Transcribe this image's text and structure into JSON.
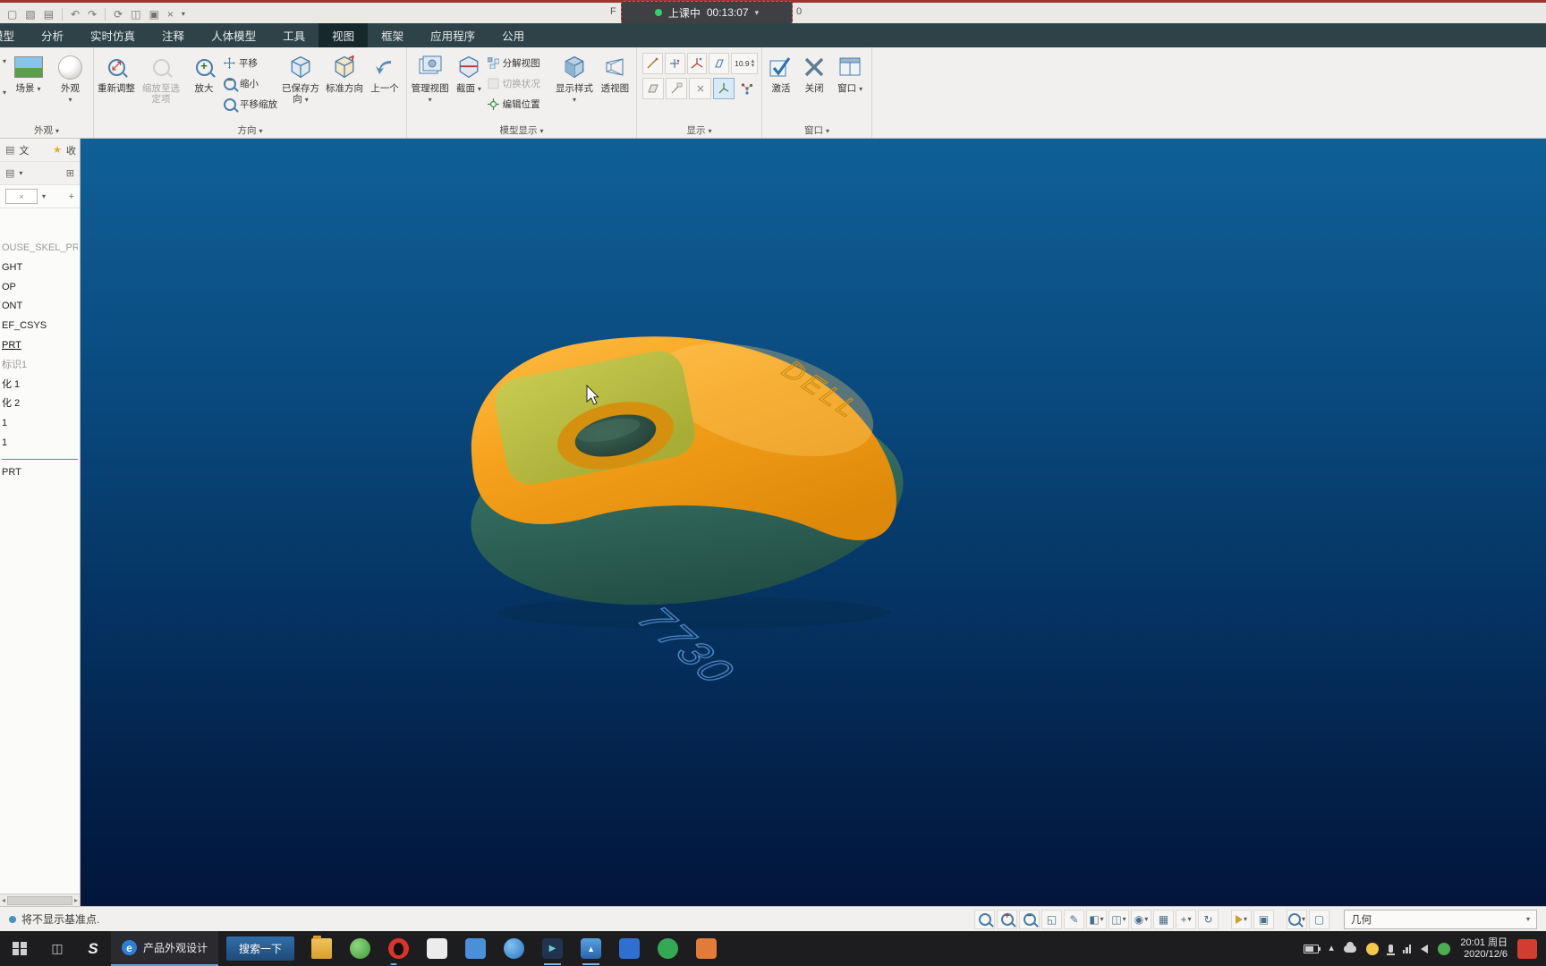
{
  "window": {
    "title_fragment_left": "F",
    "title_fragment_right": "0"
  },
  "quick_access": {
    "icons": [
      {
        "name": "new-file-icon",
        "glyph": "▢"
      },
      {
        "name": "open-file-icon",
        "glyph": "▧"
      },
      {
        "name": "save-icon",
        "glyph": "▤"
      },
      {
        "name": "undo-icon",
        "glyph": "↶"
      },
      {
        "name": "redo-icon",
        "glyph": "↷"
      },
      {
        "name": "regenerate-icon",
        "glyph": "⟳"
      },
      {
        "name": "model-display-icon",
        "glyph": "◫"
      },
      {
        "name": "windows-icon",
        "glyph": "▣"
      },
      {
        "name": "close-icon",
        "glyph": "×"
      }
    ],
    "caret": "▾"
  },
  "timer": {
    "label": "上课中",
    "time": "00:13:07",
    "caret": "▾"
  },
  "ribbon": {
    "tabs": [
      {
        "label": "模型"
      },
      {
        "label": "分析"
      },
      {
        "label": "实时仿真"
      },
      {
        "label": "注释"
      },
      {
        "label": "人体模型"
      },
      {
        "label": "工具"
      },
      {
        "label": "视图"
      },
      {
        "label": "框架"
      },
      {
        "label": "应用程序"
      },
      {
        "label": "公用"
      }
    ],
    "groups": {
      "appearance": {
        "label": "外观",
        "scene": "场景",
        "appearance_btn": "外观"
      },
      "orientation": {
        "label": "方向",
        "refit": "重新调整",
        "zoom_to_selected": "缩放至选定项",
        "zoom_in": "放大",
        "pan": "平移",
        "zoom_out": "缩小",
        "pan_zoom": "平移缩放",
        "saved_orientations": "已保存方向",
        "standard_orientation": "标准方向",
        "previous": "上一个"
      },
      "model_display": {
        "label": "模型显示",
        "manage_views": "管理视图",
        "sections": "截面",
        "exploded_view": "分解视图",
        "switch_state": "切换状况",
        "edit_position": "编辑位置",
        "display_style": "显示样式",
        "perspective": "透视图"
      },
      "show": {
        "label": "显示",
        "tolerance_value": "10.9"
      },
      "window_group": {
        "label": "窗口",
        "activate": "激活",
        "close": "关闭",
        "window": "窗口"
      }
    }
  },
  "tree_panel": {
    "tab_label": "文",
    "collapse_label": "收",
    "items": [
      {
        "label": "OUSE_SKEL_PRT"
      },
      {
        "label": "GHT"
      },
      {
        "label": "OP"
      },
      {
        "label": "ONT"
      },
      {
        "label": "EF_CSYS"
      },
      {
        "label": "PRT"
      },
      {
        "label": "标识1"
      },
      {
        "label": "化 1"
      },
      {
        "label": "化 2"
      },
      {
        "label": "1"
      },
      {
        "label": "1"
      },
      {
        "label": "PRT"
      }
    ]
  },
  "viewport": {
    "brand_text": "DELL",
    "reflection_text": "7730"
  },
  "status_bar": {
    "message": "将不显示基准点.",
    "selection_filter_label": "几何"
  },
  "taskbar": {
    "task_app_label": "产品外观设计",
    "search_label": "搜索一下",
    "tray_time": "20:01 周日",
    "tray_date": "2020/12/6"
  },
  "glyphs": {
    "caret": "▾",
    "plus": "+",
    "minus": "−",
    "check": "✓",
    "cross": "×",
    "window_grid": "⊞",
    "back_arrow": "↩",
    "left_tri": "◂",
    "right_tri": "▸",
    "up_tri": "▴",
    "star": "★",
    "e_letter": "e",
    "s_letter": "S",
    "pan": "+"
  }
}
